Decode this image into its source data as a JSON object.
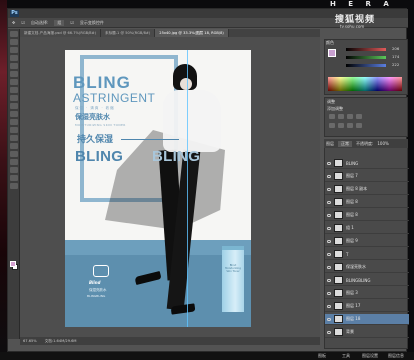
{
  "brand": {
    "overlay_text": "H E R A"
  },
  "watermark": {
    "text": "搜狐视频",
    "url": "tv.sohu.com"
  },
  "app": {
    "logo": "Ps"
  },
  "options_bar": {
    "items": [
      "自动选择:",
      "组",
      "显示变换控件"
    ]
  },
  "doc_tabs": [
    {
      "label": "新建文档-产品海报.psd @ 66.7%(RGB/8#)",
      "active": false
    },
    {
      "label": "未标题-1 @ 50%(RGB/8#)",
      "active": false
    },
    {
      "label": "25x40.jpg @ 33.3%(图层 18, RGB/8)",
      "active": true
    }
  ],
  "poster": {
    "title": "BLING",
    "subtitle": "ASTRINGENT",
    "sub_cn": "保湿 · 清爽 · 收缩",
    "product_cn": "保湿亮肤水",
    "tagline": "MOISTURIZING SKIN TONER",
    "lasting_cn": "持久保湿",
    "bling_a": "BLING",
    "bling_b": "BLING",
    "logo_text": "Blind",
    "logo_cn": "保湿亮肤水",
    "logo_en": "BLINGBLING",
    "product_label": "Blind Moisturizing Skin Toner"
  },
  "status": {
    "zoom": "67.65%",
    "doc": "文档:1.64M/29.6M"
  },
  "color_panel": {
    "tab_label": "颜色",
    "rows": [
      {
        "label": "R",
        "value": "206",
        "color": "#e05a5a"
      },
      {
        "label": "G",
        "value": "174",
        "color": "#5ac85a"
      },
      {
        "label": "B",
        "value": "222",
        "color": "#5a7ee0"
      }
    ],
    "fg_color": "#c8a0d0"
  },
  "adjustments": {
    "title": "调整",
    "subtitle": "添加调整"
  },
  "layers": {
    "title": "图层",
    "mode": "正常",
    "opacity_label": "不透明度:",
    "opacity_value": "100%",
    "items": [
      {
        "name": "BLING",
        "selected": false
      },
      {
        "name": "图层 7",
        "selected": false
      },
      {
        "name": "图层 8 副本",
        "selected": false
      },
      {
        "name": "图层 8",
        "selected": false
      },
      {
        "name": "图层 8",
        "selected": false
      },
      {
        "name": "组 1",
        "selected": false
      },
      {
        "name": "图层 9",
        "selected": false
      },
      {
        "name": "T",
        "selected": false
      },
      {
        "name": "保湿亮肤水",
        "selected": false
      },
      {
        "name": "BLINGBLING",
        "selected": false
      },
      {
        "name": "图层 3",
        "selected": false
      },
      {
        "name": "图层 17",
        "selected": false
      },
      {
        "name": "图层 18",
        "selected": true
      },
      {
        "name": "背景",
        "selected": false
      }
    ]
  },
  "taskbar": {
    "items": [
      "图板",
      "工具",
      "图层设置",
      "图层信息"
    ]
  }
}
